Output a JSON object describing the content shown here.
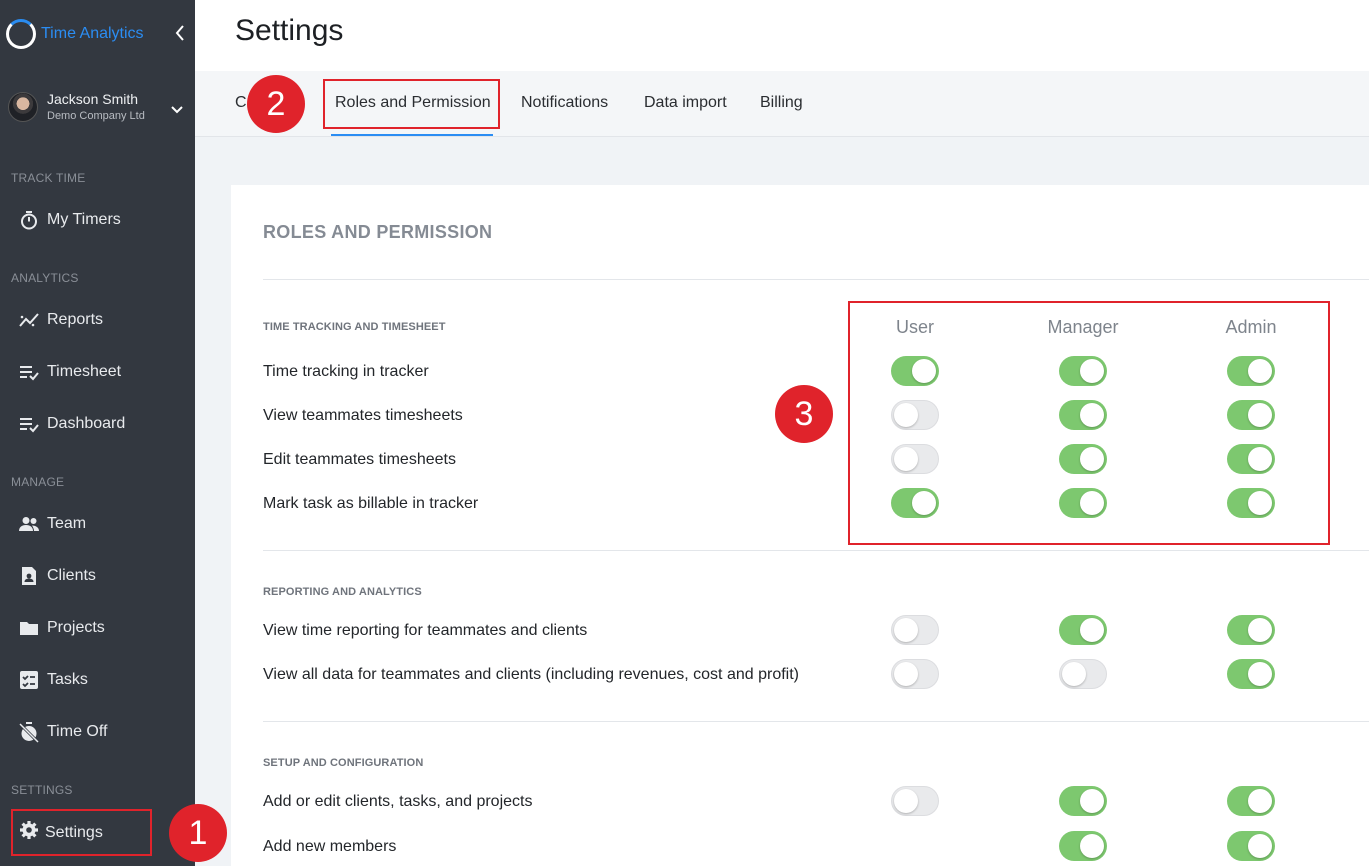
{
  "app": {
    "name": "Time Analytics"
  },
  "user": {
    "name": "Jackson Smith",
    "company": "Demo Company Ltd"
  },
  "sidebar": {
    "sections": [
      "TRACK TIME",
      "ANALYTICS",
      "MANAGE",
      "SETTINGS"
    ],
    "items": [
      {
        "label": "My Timers",
        "icon": "stopwatch-icon"
      },
      {
        "label": "Reports",
        "icon": "trend-icon"
      },
      {
        "label": "Timesheet",
        "icon": "list-check-icon"
      },
      {
        "label": "Dashboard",
        "icon": "list-check-icon"
      },
      {
        "label": "Team",
        "icon": "people-icon"
      },
      {
        "label": "Clients",
        "icon": "contact-icon"
      },
      {
        "label": "Projects",
        "icon": "folder-icon"
      },
      {
        "label": "Tasks",
        "icon": "tasks-icon"
      },
      {
        "label": "Time Off",
        "icon": "timer-off-icon"
      },
      {
        "label": "Settings",
        "icon": "gear-icon"
      }
    ]
  },
  "page": {
    "title": "Settings"
  },
  "tabs": [
    {
      "label": "C"
    },
    {
      "label": "Roles and Permission",
      "active": true
    },
    {
      "label": "Notifications"
    },
    {
      "label": "Data import"
    },
    {
      "label": "Billing"
    }
  ],
  "markers": [
    "1",
    "2",
    "3"
  ],
  "card": {
    "title": "ROLES AND PERMISSION",
    "columns": [
      "User",
      "Manager",
      "Admin"
    ],
    "groups": [
      {
        "label": "TIME TRACKING AND TIMESHEET",
        "rows": [
          {
            "label": "Time tracking in tracker",
            "values": [
              true,
              true,
              true
            ]
          },
          {
            "label": "View teammates timesheets",
            "values": [
              false,
              true,
              true
            ]
          },
          {
            "label": "Edit teammates timesheets",
            "values": [
              false,
              true,
              true
            ]
          },
          {
            "label": "Mark task as billable in tracker",
            "values": [
              true,
              true,
              true
            ]
          }
        ]
      },
      {
        "label": "REPORTING AND ANALYTICS",
        "rows": [
          {
            "label": "View time reporting for teammates and clients",
            "values": [
              false,
              true,
              true
            ]
          },
          {
            "label": "View all data for teammates and clients (including revenues, cost and profit)",
            "values": [
              false,
              false,
              true
            ]
          }
        ]
      },
      {
        "label": "SETUP AND CONFIGURATION",
        "rows": [
          {
            "label": "Add or edit clients, tasks, and projects",
            "values": [
              false,
              true,
              true
            ]
          },
          {
            "label": "Add new members",
            "values": [
              null,
              true,
              true
            ]
          }
        ]
      }
    ]
  },
  "colors": {
    "accent": "#2b8df3",
    "toggle_on": "#7dc86f",
    "toggle_off": "#e9eaec",
    "annotation": "#e0232b",
    "sidebar": "#333840"
  }
}
